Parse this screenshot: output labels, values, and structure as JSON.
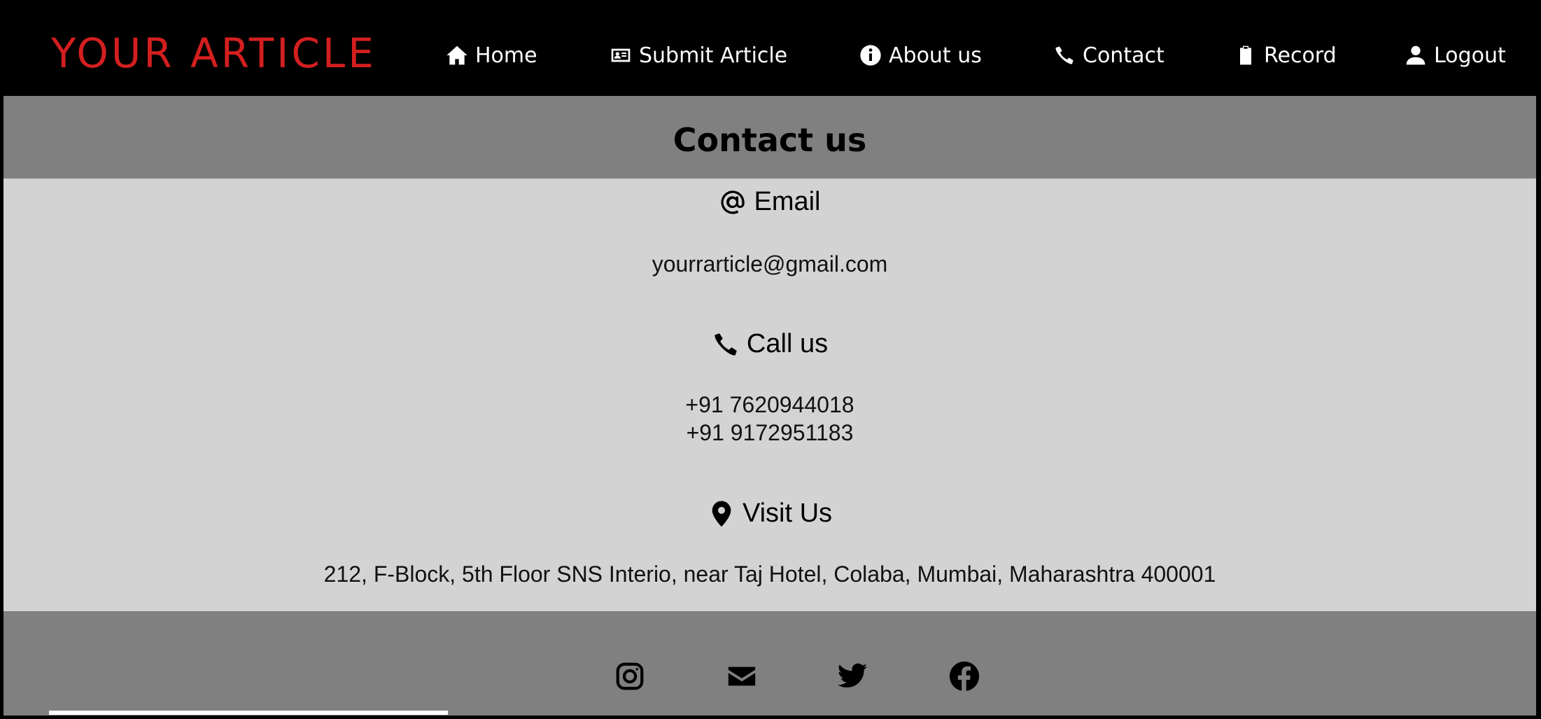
{
  "brand": "YOUR ARTICLE",
  "colors": {
    "brand": "#d41f1f",
    "navbar": "#000000",
    "band": "#808080",
    "content": "#d3d3d3"
  },
  "nav": {
    "home": {
      "label": "Home",
      "icon": "home-icon"
    },
    "submit": {
      "label": "Submit Article",
      "icon": "id-card-icon"
    },
    "about": {
      "label": "About us",
      "icon": "info-circle-icon"
    },
    "contact": {
      "label": "Contact",
      "icon": "phone-icon"
    },
    "record": {
      "label": "Record",
      "icon": "clipboard-icon"
    },
    "logout": {
      "label": "Logout",
      "icon": "user-icon"
    }
  },
  "page_title": "Contact us",
  "email": {
    "heading": "Email",
    "icon": "at-icon",
    "value": "yourrarticle@gmail.com"
  },
  "call": {
    "heading": "Call us",
    "icon": "phone-icon",
    "phone1": "+91 7620944018",
    "phone2": "+91 9172951183"
  },
  "visit": {
    "heading": "Visit Us",
    "icon": "map-pin-icon",
    "address": "212, F-Block, 5th Floor SNS Interio, near Taj Hotel, Colaba, Mumbai, Maharashtra 400001"
  },
  "social": [
    "instagram-icon",
    "envelope-icon",
    "twitter-icon",
    "facebook-icon"
  ]
}
